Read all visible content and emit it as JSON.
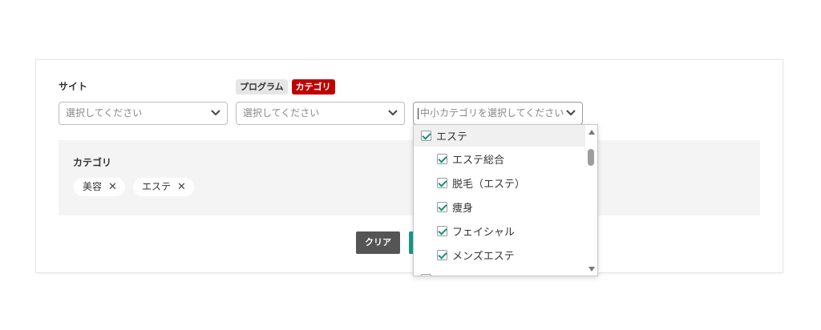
{
  "form": {
    "site_label": "サイト",
    "tabs": [
      {
        "label": "プログラム"
      },
      {
        "label": "カテゴリ"
      }
    ],
    "site_select": {
      "placeholder": "選択してください"
    },
    "program_select": {
      "placeholder": "選択してください"
    },
    "category_select": {
      "placeholder": "中小カテゴリを選択してください"
    }
  },
  "selected": {
    "title": "カテゴリ",
    "chips": [
      {
        "label": "美容"
      },
      {
        "label": "エステ"
      }
    ],
    "remove_glyph": "✕"
  },
  "buttons": {
    "clear": "クリア"
  },
  "dropdown": {
    "items": [
      {
        "label": "エステ",
        "checked": true,
        "level": "parent"
      },
      {
        "label": "エステ総合",
        "checked": true,
        "level": "child"
      },
      {
        "label": "脱毛（エステ）",
        "checked": true,
        "level": "child"
      },
      {
        "label": "痩身",
        "checked": true,
        "level": "child"
      },
      {
        "label": "フェイシャル",
        "checked": true,
        "level": "child"
      },
      {
        "label": "メンズエステ",
        "checked": true,
        "level": "child"
      }
    ],
    "scroll_position": 0.1
  },
  "colors": {
    "accent": "#1a9a86",
    "category_tab": "#c00000",
    "clear_button": "#555555"
  }
}
